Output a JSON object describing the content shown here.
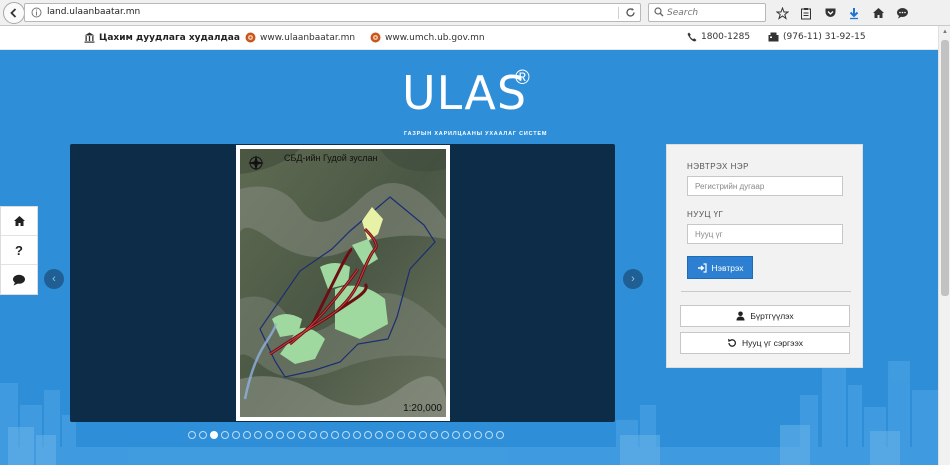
{
  "browser": {
    "url": "land.ulaanbaatar.mn",
    "search_placeholder": "Search"
  },
  "info_bar": {
    "auction_label": "Цахим дуудлага худалдаа",
    "site1": "www.ulaanbaatar.mn",
    "site2": "www.umch.ub.gov.mn",
    "phone": "1800-1285",
    "fax": "(976-11) 31-92-15"
  },
  "logo": {
    "name": "ULAS",
    "registered": "®",
    "subtitle": "ГАЗРЫН ХАРИЛЦААНЫ УХААЛАГ СИСТЕМ"
  },
  "slider": {
    "map_title": "СБД-ийн Гудой зуслан",
    "map_scale": "1:20,000",
    "prev_symbol": "‹",
    "next_symbol": "›",
    "slide_count": 29,
    "active_index": 2
  },
  "side_nav": {
    "help_symbol": "?"
  },
  "login": {
    "username_label": "НЭВТРЭХ НЭР",
    "username_placeholder": "Регистрийн дугаар",
    "password_label": "НУУЦ ҮГ",
    "password_placeholder": "Нууц үг",
    "login_button": "Нэвтрэх",
    "register_button": "Бүртгүүлэх",
    "reset_button": "Нууц үг сэргээх"
  },
  "colors": {
    "hero_bg": "#2e8fd8",
    "slider_bg": "#0d2c47",
    "primary_button": "#2d80d1"
  },
  "icons": [
    "back-arrow-icon",
    "info-icon",
    "reload-icon",
    "search-icon",
    "star-icon",
    "clipboard-icon",
    "pocket-icon",
    "download-icon",
    "home-icon",
    "chat-icon",
    "bank-icon",
    "globe-icon",
    "phone-icon",
    "fax-icon",
    "compass-icon",
    "sign-in-icon",
    "user-icon",
    "refresh-icon",
    "help-icon"
  ]
}
